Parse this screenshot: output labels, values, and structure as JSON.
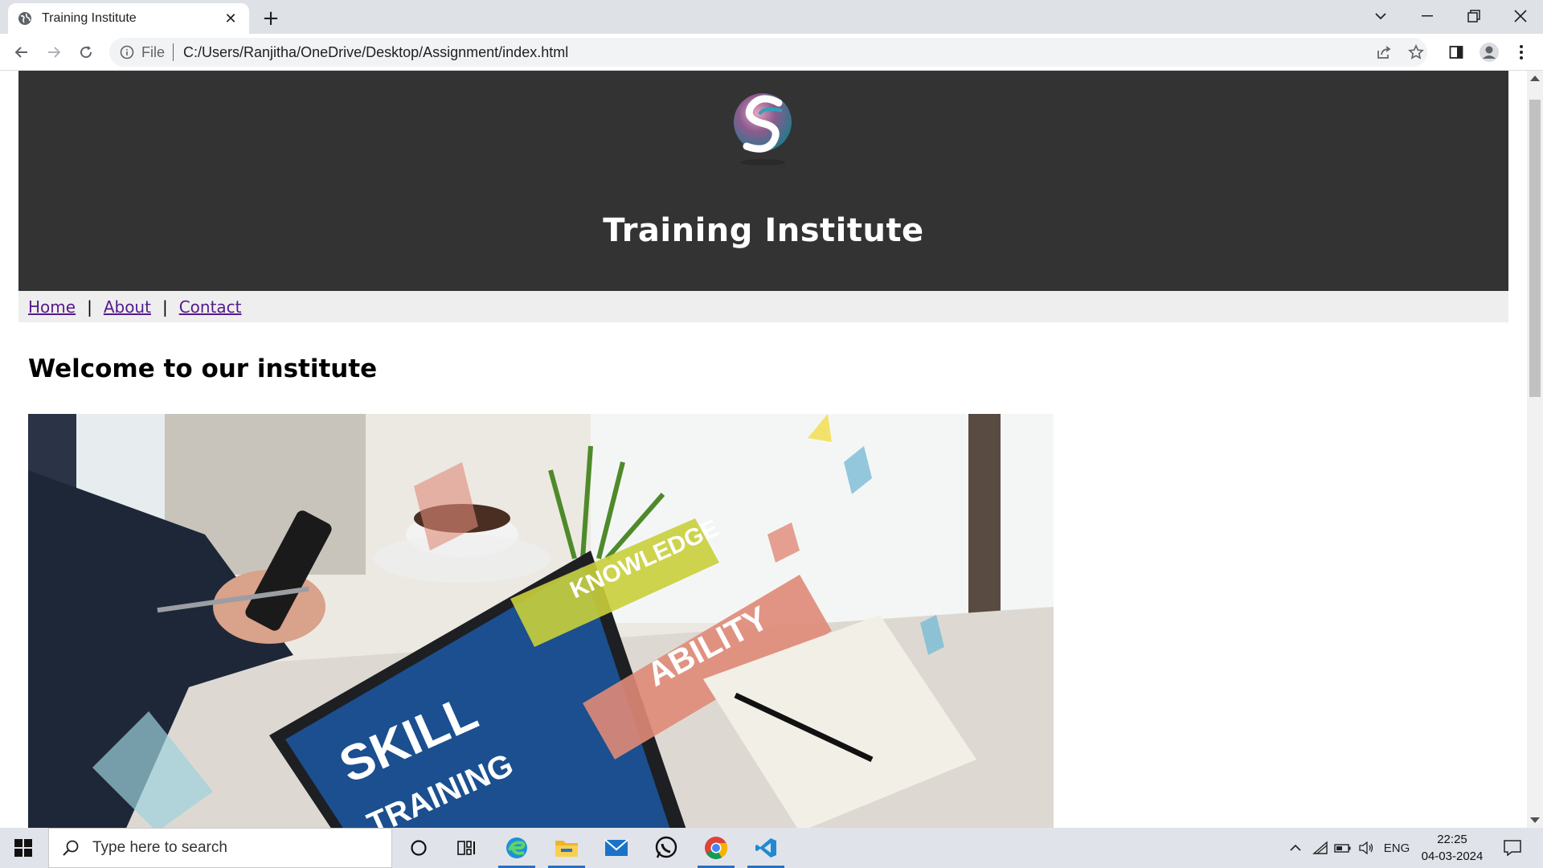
{
  "browser": {
    "tab_title": "Training Institute",
    "url_scheme": "File",
    "url": "C:/Users/Ranjitha/OneDrive/Desktop/Assignment/index.html"
  },
  "page": {
    "site_title": "Training Institute",
    "nav": [
      {
        "label": "Home"
      },
      {
        "label": "About"
      },
      {
        "label": "Contact"
      }
    ],
    "nav_separator": "|",
    "welcome_heading": "Welcome to our institute",
    "hero_words": {
      "skill": "SKILL",
      "knowledge": "KNOWLEDGE",
      "ability": "ABILITY",
      "training": "TRAINING"
    }
  },
  "taskbar": {
    "search_placeholder": "Type here to search",
    "language": "ENG",
    "time": "22:25",
    "date": "04-03-2024"
  },
  "colors": {
    "header_bg": "#333333",
    "nav_bg": "#eeeeee",
    "link": "#551a8b",
    "taskbar_bg": "#e1e3ea"
  }
}
